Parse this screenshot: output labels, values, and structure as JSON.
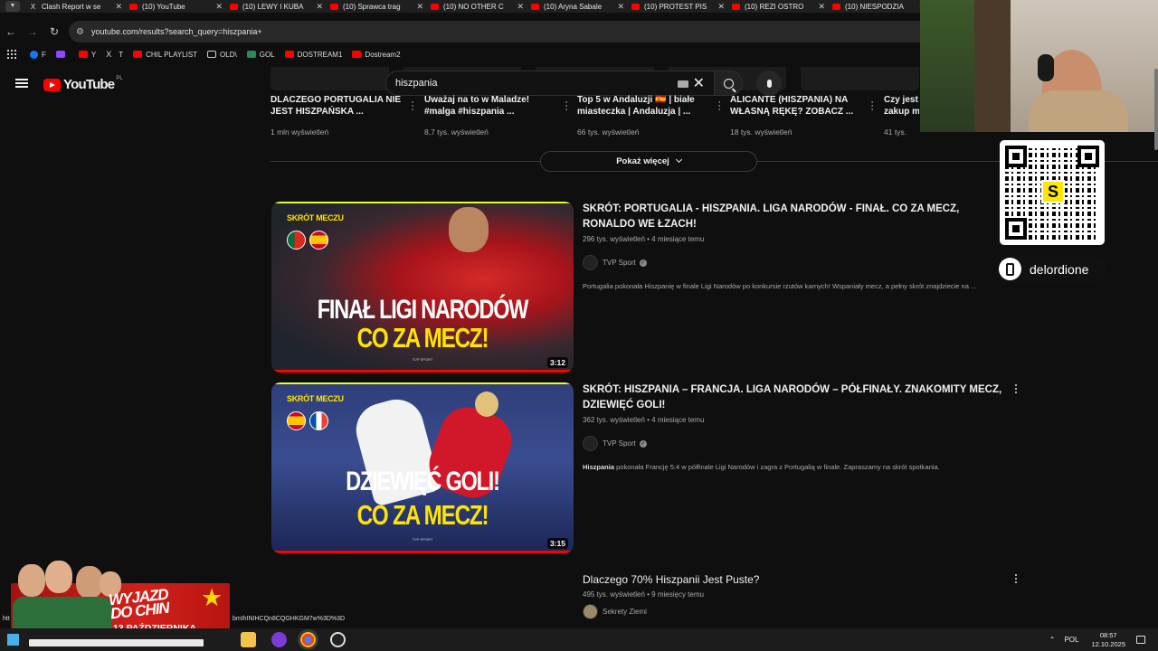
{
  "browser": {
    "tabs": [
      {
        "title": "Clash Report w se",
        "icon": "x-icon"
      },
      {
        "title": "(10) YouTube",
        "icon": "youtube-icon"
      },
      {
        "title": "(10) LEWY I KUBA",
        "icon": "youtube-icon"
      },
      {
        "title": "(10) Sprawca trag",
        "icon": "youtube-icon"
      },
      {
        "title": "(10) NO OTHER C",
        "icon": "youtube-icon"
      },
      {
        "title": "(10) Aryna Sabale",
        "icon": "youtube-icon"
      },
      {
        "title": "(10) PROTEST PIS",
        "icon": "youtube-icon"
      },
      {
        "title": "(10) REZI OSTRO",
        "icon": "youtube-icon"
      },
      {
        "title": "(10) NIESPODZIA",
        "icon": "youtube-icon"
      }
    ],
    "url": "youtube.com/results?search_query=hiszpania+",
    "bookmarks": [
      {
        "label": "F",
        "color": "#1877f2"
      },
      {
        "label": "",
        "color": "#9146ff"
      },
      {
        "label": "Y",
        "color": "#ff0000"
      },
      {
        "label": "T",
        "color": "#000000"
      },
      {
        "label": "CHIL PLAYLIST",
        "color": "#ff0000"
      },
      {
        "label": "OLD\\",
        "color": "#cccccc"
      },
      {
        "label": "GOL",
        "color": "#2a8a5a"
      },
      {
        "label": "DOSTREAM1",
        "color": "#ff0000"
      },
      {
        "label": "Dostream2",
        "color": "#ff0000"
      }
    ]
  },
  "youtube": {
    "logo": "YouTube",
    "region": "PL",
    "search_value": "hiszpania",
    "shorts_strip": [
      {
        "title": "DLACZEGO PORTUGALIA NIE JEST HISZPAŃSKA ...",
        "views": "1 mln wyświetleń"
      },
      {
        "title": "Uważaj na to w Maladze! #malga #hiszpania ...",
        "views": "8,7 tys. wyświetleń"
      },
      {
        "title": "Top 5 w Andaluzji 🇪🇸 | białe miasteczka | Andaluzja | ...",
        "views": "66 tys. wyświetleń"
      },
      {
        "title": "ALICANTE (HISZPANIA) NA WŁASNĄ RĘKĘ? ZOBACZ ...",
        "views": "18 tys. wyświetleń"
      },
      {
        "title": "Czy jest zakup m",
        "views": "41 tys."
      }
    ],
    "show_more": "Pokaż więcej",
    "videos": [
      {
        "title": "SKRÓT: PORTUGALIA - HISZPANIA. LIGA NARODÓW - FINAŁ. CO ZA MECZ, RONALDO WE ŁZACH!",
        "meta": "296 tys. wyświetleń • 4 miesiące temu",
        "channel": "TVP Sport",
        "description_bold": "",
        "description": "Portugalia pokonała Hiszpanię w finale Ligi Narodów po konkursie rzutów karnych! Wspaniały mecz, a pełny skrót znajdziecie na ...",
        "thumb_tag": "SKRÓT MECZU",
        "thumb_line1": "FINAŁ LIGI NARODÓW",
        "thumb_line2": "CO ZA MECZ!",
        "thumb_brand": "TVP SPORT",
        "duration": "3:12"
      },
      {
        "title": "SKRÓT: HISZPANIA – FRANCJA. LIGA NARODÓW – PÓŁFINAŁY. ZNAKOMITY MECZ, DZIEWIĘĆ GOLI!",
        "meta": "362 tys. wyświetleń • 4 miesiące temu",
        "channel": "TVP Sport",
        "description_bold": "Hiszpania",
        "description": " pokonała Francję 5:4 w półfinale Ligi Narodów i zagra z Portugalią w finale. Zapraszamy na skrót spotkania.",
        "thumb_tag": "SKRÓT MECZU",
        "thumb_line1": "DZIEWIĘĆ GOLI!",
        "thumb_line2": "CO ZA MECZ!",
        "thumb_brand": "TVP SPORT",
        "duration": "3:15"
      },
      {
        "title": "Dlaczego 70% Hiszpanii Jest Puste?",
        "meta": "495 tys. wyświetleń • 9 miesięcy temu",
        "channel": "Sekrety Ziemi"
      }
    ]
  },
  "overlay": {
    "handle": "delordione",
    "qr_letter": "S",
    "banner_line1": "WYJAZD",
    "banner_line2": "DO CHIN",
    "banner_date": "13 PAŹDZIERNIKA"
  },
  "status_url_fragment": "bmIhINIHCQn8CQGHKGM7w%3D%3D",
  "status_url_prefix": "htt",
  "taskbar": {
    "lang": "POL",
    "time": "08:57",
    "date": "12.10.2025"
  }
}
